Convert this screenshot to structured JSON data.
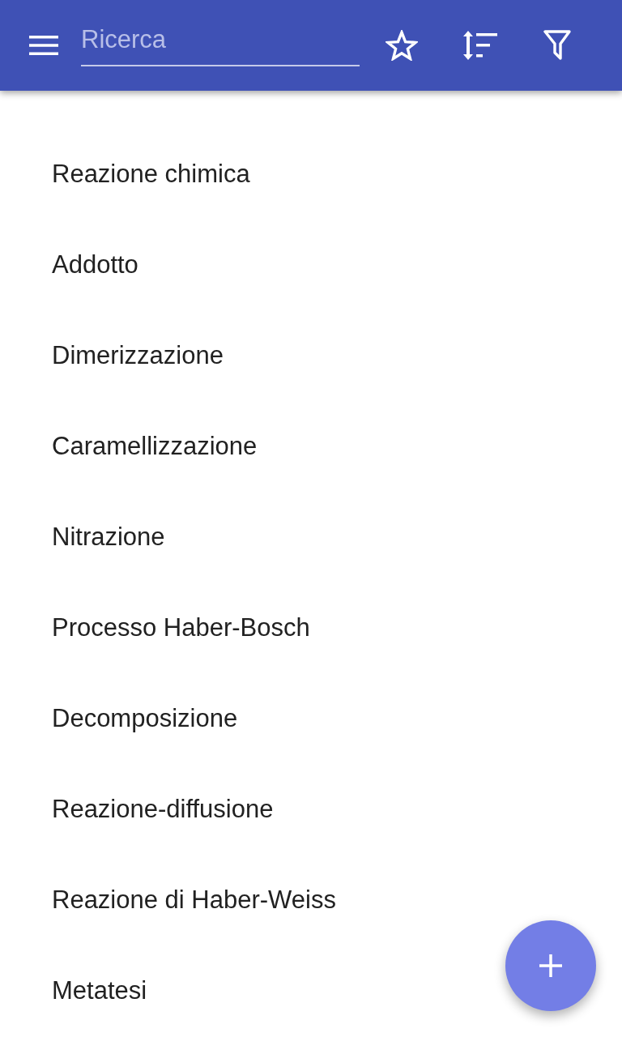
{
  "app_bar": {
    "search": {
      "placeholder": "Ricerca"
    }
  },
  "items": [
    {
      "label": "Reazione chimica"
    },
    {
      "label": "Addotto"
    },
    {
      "label": "Dimerizzazione"
    },
    {
      "label": "Caramellizzazione"
    },
    {
      "label": "Nitrazione"
    },
    {
      "label": "Processo Haber-Bosch"
    },
    {
      "label": "Decomposizione"
    },
    {
      "label": "Reazione-diffusione"
    },
    {
      "label": "Reazione di Haber-Weiss"
    },
    {
      "label": "Metatesi"
    }
  ]
}
